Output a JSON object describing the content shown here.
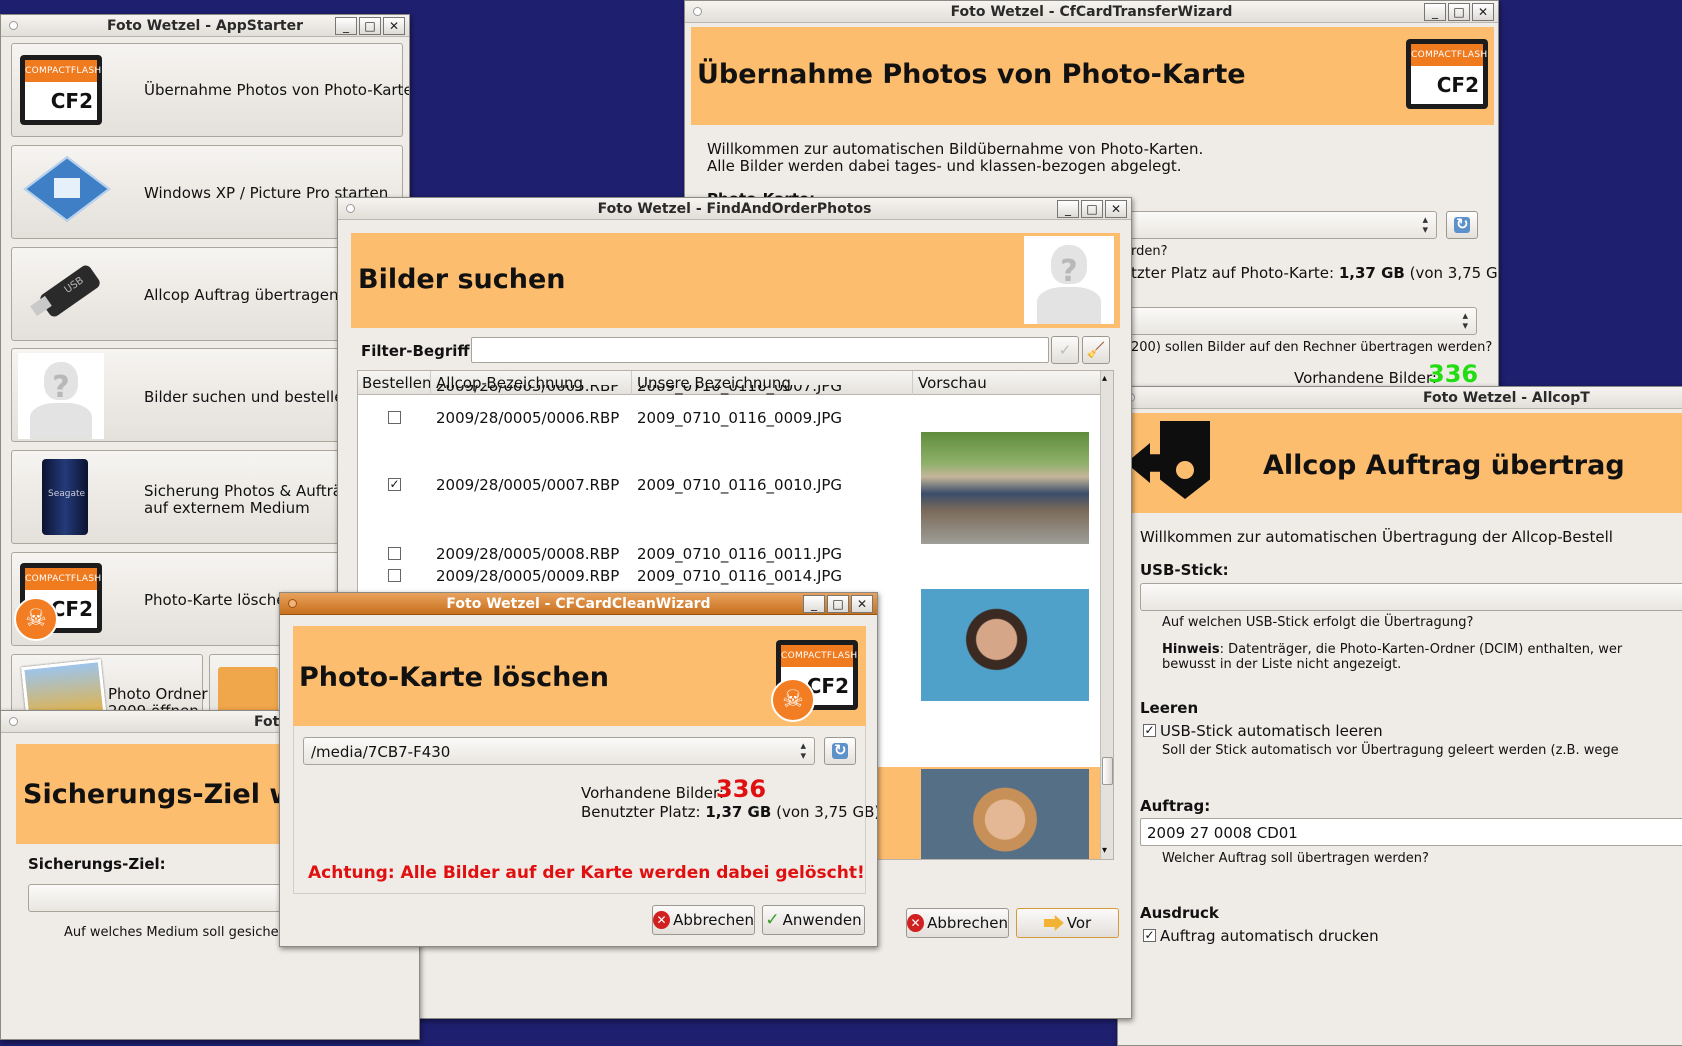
{
  "appstarter": {
    "title": "Foto Wetzel - AppStarter",
    "items": [
      {
        "label": "Übernahme Photos von Photo-Karte"
      },
      {
        "label": "Windows XP / Picture Pro starten"
      },
      {
        "label": "Allcop Auftrag übertragen"
      },
      {
        "label": "Bilder suchen und bestellen"
      },
      {
        "label": "Sicherung Photos & Aufträge",
        "label2": "auf externem Medium"
      },
      {
        "label": "Photo-Karte löschen"
      }
    ],
    "photo_folder": {
      "label": "Photo Ordner",
      "label2": "2009 öffnen"
    },
    "cf_card_top": "COMPACTFLASH",
    "cf_card_label": "CF2",
    "usb_label": "USB"
  },
  "transfer": {
    "title": "Foto Wetzel - CfCardTransferWizard",
    "heading": "Übernahme Photos von Photo-Karte",
    "intro1": "Willkommen zur automatischen Bildübernahme von Photo-Karten.",
    "intro2": "Alle Bilder werden dabei tages- und klassen-bezogen abgelegt.",
    "card_label": "Photo-Karte:",
    "hint_partial": "rden?",
    "used_label": "tzter Platz auf Photo-Karte:",
    "used_value": "1,37 GB",
    "used_total": "(von 3,75 GB)",
    "question_partial": "200) sollen Bilder auf den Rechner übertragen werden?",
    "images_label": "Vorhandene Bilder:",
    "images_count": "336"
  },
  "find": {
    "title": "Foto Wetzel - FindAndOrderPhotos",
    "heading": "Bilder suchen",
    "filter_label": "Filter-Begriff:",
    "filter_value": "",
    "columns": [
      "Bestellen",
      "Allcop-Bezeichnung",
      "Unsere Bezeichnung",
      "Vorschau"
    ],
    "partial_row": {
      "allcop": "2009/28/0005/0005.RBP",
      "ours": "2009_0710_0116_0007.JPG"
    },
    "rows": [
      {
        "checked": false,
        "allcop": "2009/28/0005/0006.RBP",
        "ours": "2009_0710_0116_0009.JPG"
      },
      {
        "checked": true,
        "allcop": "2009/28/0005/0007.RBP",
        "ours": "2009_0710_0116_0010.JPG"
      },
      {
        "checked": false,
        "allcop": "2009/28/0005/0008.RBP",
        "ours": "2009_0710_0116_0011.JPG"
      },
      {
        "checked": false,
        "allcop": "2009/28/0005/0009.RBP",
        "ours": "2009_0710_0116_0014.JPG"
      }
    ],
    "cancel_label": "Abbrechen",
    "next_label": "Vor"
  },
  "clean": {
    "title": "Foto Wetzel - CFCardCleanWizard",
    "heading": "Photo-Karte löschen",
    "path": "/media/7CB7-F430",
    "images_label": "Vorhandene Bilder:",
    "images_count": "336",
    "used_label": "Benutzter Platz:",
    "used_value": "1,37 GB",
    "used_total": "(von 3,75 GB)",
    "warning": "Achtung: Alle Bilder auf der Karte werden dabei gelöscht!",
    "cancel_label": "Abbrechen",
    "apply_label": "Anwenden"
  },
  "backup": {
    "title_partial": "Foto",
    "heading_partial": "Sicherungs-Ziel wä",
    "target_label": "Sicherungs-Ziel:",
    "hint_partial": "Auf welches Medium soll gesichert we"
  },
  "allcop": {
    "title_partial": "Foto Wetzel - AllcopT",
    "heading_partial": "Allcop Auftrag übertrag",
    "intro_partial": "Willkommen zur automatischen Übertragung der Allcop-Bestell",
    "usb_label": "USB-Stick:",
    "usb_hint": "Auf welchen USB-Stick erfolgt die Übertragung?",
    "note_bold": "Hinweis",
    "note_text": ": Datenträger, die Photo-Karten-Ordner (DCIM) enthalten, wer",
    "note_text2": "bewusst in der Liste nicht angezeigt.",
    "empty_heading": "Leeren",
    "empty_checkbox": "USB-Stick automatisch leeren",
    "empty_hint": "Soll der Stick automatisch vor Übertragung geleert werden (z.B. wege",
    "order_label": "Auftrag:",
    "order_value": "2009 27 0008 CD01",
    "order_hint": "Welcher Auftrag soll übertragen werden?",
    "print_heading": "Ausdruck",
    "print_checkbox": "Auftrag automatisch drucken"
  },
  "colors": {
    "banner": "#fdbd6e",
    "desktop": "#1e1f6e",
    "green_count": "#22dd11",
    "red_count": "#e01010",
    "warning": "#e01010"
  }
}
